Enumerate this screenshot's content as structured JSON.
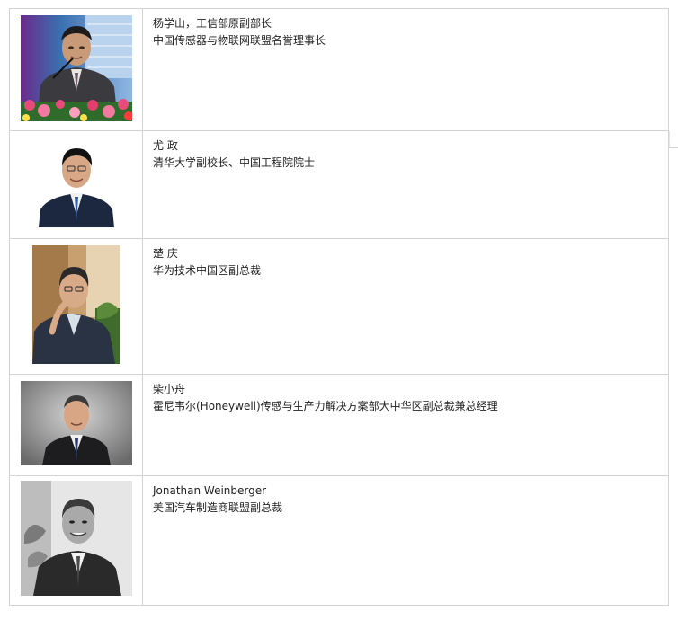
{
  "people": [
    {
      "name": "杨学山，工信部原副部长",
      "title": "中国传感器与物联网联盟名誉理事长",
      "photo_icon": "portrait-speaker-podium-flowers"
    },
    {
      "name": "尤  政",
      "title": "清华大学副校长、中国工程院院士",
      "photo_icon": "portrait-suit-white-background"
    },
    {
      "name": "楚  庆",
      "title": "华为技术中国区副总裁",
      "photo_icon": "portrait-glasses-office"
    },
    {
      "name": "柴小舟",
      "title": "霍尼韦尔(Honeywell)传感与生产力解决方案部大中华区副总裁兼总经理",
      "photo_icon": "portrait-suit-gray-background"
    },
    {
      "name": "Jonathan  Weinberger",
      "title": "美国汽车制造商联盟副总裁",
      "photo_icon": "portrait-black-and-white"
    }
  ]
}
